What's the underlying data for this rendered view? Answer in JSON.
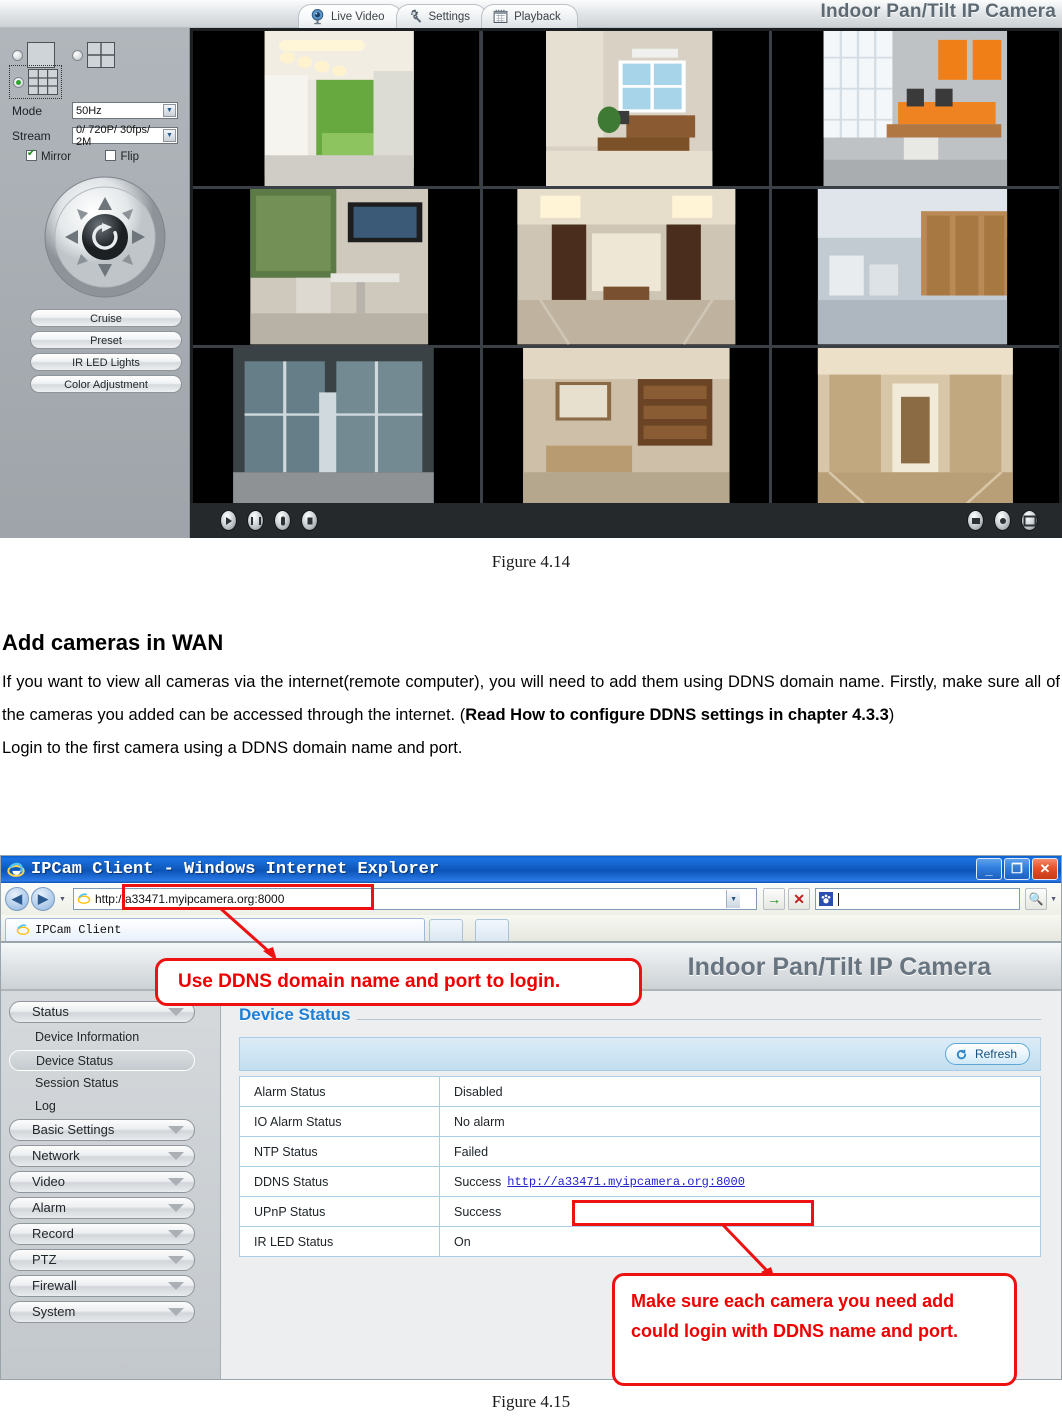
{
  "figure_414": {
    "app_title": "Indoor Pan/Tilt IP Camera",
    "tabs": [
      {
        "label": "Live Video",
        "icon": "camera-icon",
        "active": true
      },
      {
        "label": "Settings",
        "icon": "gear-wrench-icon",
        "active": false
      },
      {
        "label": "Playback",
        "icon": "calendar-icon",
        "active": false
      }
    ],
    "controls": {
      "mode_label": "Mode",
      "mode_value": "50Hz",
      "stream_label": "Stream",
      "stream_value": "0/ 720P/ 30fps/ 2M",
      "mirror_label": "Mirror",
      "mirror_checked": true,
      "flip_label": "Flip",
      "flip_checked": false,
      "layout_selected": "grid-9"
    },
    "ptz_buttons": [
      "Cruise",
      "Preset",
      "IR LED Lights",
      "Color Adjustment"
    ],
    "video_toolbar_left": [
      "play-icon",
      "pause-icon",
      "microphone-icon",
      "speaker-icon"
    ],
    "video_toolbar_right": [
      "snapshot-icon",
      "record-icon",
      "fullscreen-icon"
    ],
    "grid_cells": 9,
    "caption": "Figure 4.14"
  },
  "document": {
    "heading": "Add cameras in WAN",
    "paragraph_1_part1": "If you want to view all cameras via the internet(remote computer), you will need to add them using DDNS domain name. Firstly, make sure all of the cameras you added can be accessed through the internet. (",
    "paragraph_1_bold": "Read How to configure DDNS settings in chapter 4.3.3",
    "paragraph_1_part2": ")",
    "paragraph_2": "Login to the first camera using a DDNS domain name and port."
  },
  "figure_415": {
    "window_title": "IPCam Client - Windows Internet Explorer",
    "window_buttons": [
      "minimize-button",
      "maximize-button",
      "close-button"
    ],
    "address_value": "http://a33471.myipcamera.org:8000",
    "nav_back": "back-button",
    "nav_forward": "forward-button",
    "go_button": "go-arrow-icon",
    "stop_button": "stop-x-icon",
    "search_placeholder": "",
    "search_icon": "magnifier-icon",
    "tab_label": "IPCam Client",
    "banner_title": "Indoor Pan/Tilt IP Camera",
    "sidebar": [
      {
        "label": "Status",
        "type": "main",
        "expanded": true
      },
      {
        "label": "Device Information",
        "type": "sub",
        "active": false
      },
      {
        "label": "Device Status",
        "type": "sub",
        "active": true
      },
      {
        "label": "Session Status",
        "type": "sub",
        "active": false
      },
      {
        "label": "Log",
        "type": "sub",
        "active": false
      },
      {
        "label": "Basic Settings",
        "type": "main",
        "expanded": false
      },
      {
        "label": "Network",
        "type": "main",
        "expanded": false
      },
      {
        "label": "Video",
        "type": "main",
        "expanded": false
      },
      {
        "label": "Alarm",
        "type": "main",
        "expanded": false
      },
      {
        "label": "Record",
        "type": "main",
        "expanded": false
      },
      {
        "label": "PTZ",
        "type": "main",
        "expanded": false
      },
      {
        "label": "Firewall",
        "type": "main",
        "expanded": false
      },
      {
        "label": "System",
        "type": "main",
        "expanded": false
      }
    ],
    "panel_title": "Device Status",
    "refresh_label": "Refresh",
    "status_rows": [
      {
        "key": "Alarm Status",
        "value": "Disabled"
      },
      {
        "key": "IO Alarm Status",
        "value": "No alarm"
      },
      {
        "key": "NTP Status",
        "value": "Failed"
      },
      {
        "key": "DDNS Status",
        "value": "Success",
        "link": "http://a33471.myipcamera.org:8000"
      },
      {
        "key": "UPnP Status",
        "value": "Success"
      },
      {
        "key": "IR LED Status",
        "value": "On"
      }
    ],
    "callout_1": "Use DDNS domain name and port to login.",
    "callout_2": "Make sure each camera you need add could login with DDNS name and port.",
    "caption": "Figure 4.15"
  },
  "colors": {
    "annotation_red": "#ee0000",
    "panel_blue": "#1f7fd4",
    "link_blue": "#2222cc",
    "title_bar_blue": "#0d55b8"
  }
}
